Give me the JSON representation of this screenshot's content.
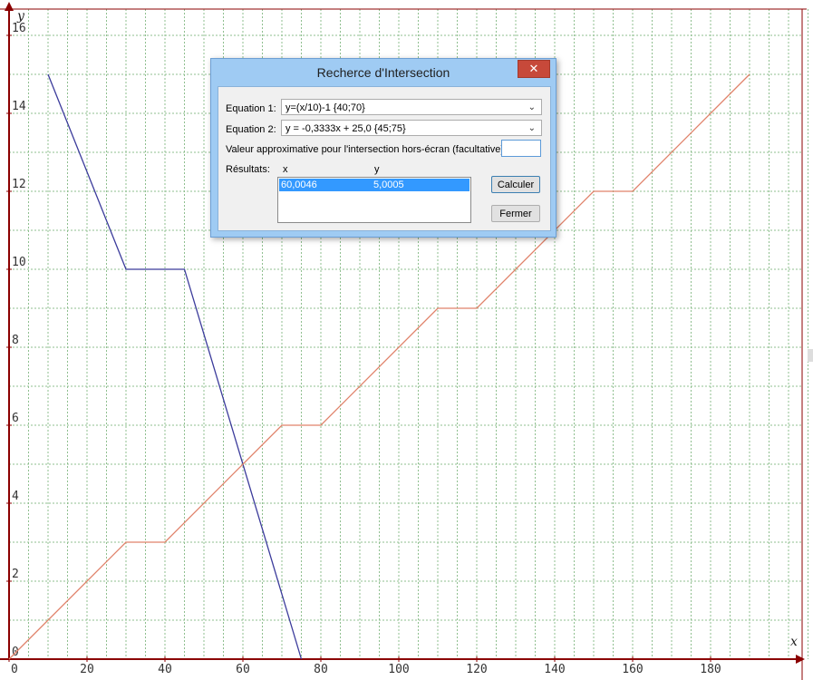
{
  "graph": {
    "x_axis_label": "x",
    "y_axis_label": "y",
    "x_ticks": [
      "0",
      "20",
      "40",
      "60",
      "80",
      "100",
      "120",
      "140",
      "160",
      "180"
    ],
    "y_ticks": [
      "0",
      "2",
      "4",
      "6",
      "8",
      "10",
      "12",
      "14",
      "16"
    ],
    "colors": {
      "grid": "#8fbf8f",
      "axis": "#8b0000",
      "series_blue": "#3b3b9b",
      "series_red": "#e0826a"
    }
  },
  "chart_data": {
    "type": "line",
    "xlim": [
      0,
      200
    ],
    "ylim": [
      0,
      16.5
    ],
    "series": [
      {
        "color": "#3b3b9b",
        "points": [
          [
            10,
            15
          ],
          [
            30,
            10
          ],
          [
            45,
            10
          ],
          [
            75,
            0
          ]
        ]
      },
      {
        "color": "#e0826a",
        "points": [
          [
            0,
            0
          ],
          [
            30,
            3
          ],
          [
            40,
            3
          ],
          [
            70,
            6
          ],
          [
            80,
            6
          ],
          [
            110,
            9
          ],
          [
            120,
            9
          ],
          [
            150,
            12
          ],
          [
            160,
            12
          ],
          [
            190,
            15
          ]
        ]
      }
    ]
  },
  "dialog": {
    "title": "Recherce d'Intersection",
    "close_glyph": "✕",
    "eq1_label": "Equation 1:",
    "eq1_value": "y=(x/10)-1 {40;70}",
    "eq2_label": "Equation 2:",
    "eq2_value": "y = -0,3333x + 25,0 {45;75}",
    "approx_label": "Valeur approximative pour l'intersection hors-écran (facultative): x  =",
    "approx_value": "",
    "results_label": "Résultats:",
    "col_x": "x",
    "col_y": "y",
    "results": [
      {
        "x": "60,0046",
        "y": "5,0005"
      }
    ],
    "calc_button": "Calculer",
    "close_button": "Fermer",
    "combo_arrow": "⌄"
  }
}
